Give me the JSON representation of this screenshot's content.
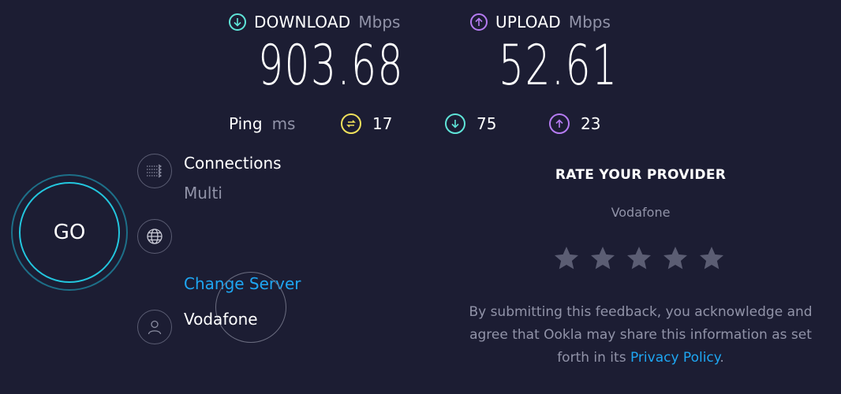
{
  "download": {
    "label": "DOWNLOAD",
    "unit": "Mbps",
    "value": "903.68",
    "icon": "arrow-down-icon",
    "color": "#5fe4d8"
  },
  "upload": {
    "label": "UPLOAD",
    "unit": "Mbps",
    "value": "52.61",
    "icon": "arrow-up-icon",
    "color": "#b57bf2"
  },
  "ping": {
    "label": "Ping",
    "unit": "ms",
    "idle": {
      "value": "17",
      "icon": "idle-latency-icon",
      "color": "#efe05b"
    },
    "download": {
      "value": "75",
      "icon": "arrow-down-icon",
      "color": "#5fe4d8"
    },
    "upload": {
      "value": "23",
      "icon": "arrow-up-icon",
      "color": "#b57bf2"
    }
  },
  "go_button": {
    "label": "GO"
  },
  "connections": {
    "title": "Connections",
    "value": "Multi",
    "icon": "connections-icon"
  },
  "server": {
    "icon": "globe-icon",
    "change_label": "Change Server"
  },
  "isp": {
    "name": "Vodafone",
    "icon": "user-icon"
  },
  "rate": {
    "title": "RATE YOUR PROVIDER",
    "provider": "Vodafone",
    "stars": 5,
    "disclaimer_line1": "By submitting this feedback, you acknowledge and",
    "disclaimer_line2": "agree that Ookla may share this information as set",
    "disclaimer_prefix": "forth in its ",
    "privacy_link": "Privacy Policy",
    "disclaimer_suffix": "."
  }
}
